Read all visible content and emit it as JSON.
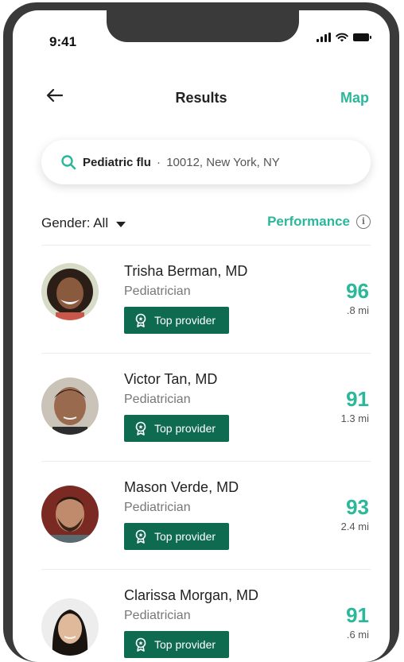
{
  "status_bar": {
    "time": "9:41"
  },
  "header": {
    "title": "Results",
    "map_label": "Map"
  },
  "search": {
    "query": "Pediatric flu",
    "separator": "·",
    "location": "10012, New York, NY"
  },
  "filters": {
    "gender_label": "Gender: All",
    "sort_label": "Performance"
  },
  "colors": {
    "accent": "#2ab79a",
    "badge": "#0e6b50"
  },
  "providers": [
    {
      "name": "Trisha Berman, MD",
      "specialty": "Pediatrician",
      "badge": "Top provider",
      "score": "96",
      "distance": ".8 mi"
    },
    {
      "name": "Victor Tan, MD",
      "specialty": "Pediatrician",
      "badge": "Top provider",
      "score": "91",
      "distance": "1.3 mi"
    },
    {
      "name": "Mason Verde, MD",
      "specialty": "Pediatrician",
      "badge": "Top provider",
      "score": "93",
      "distance": "2.4 mi"
    },
    {
      "name": "Clarissa Morgan, MD",
      "specialty": "Pediatrician",
      "badge": "Top provider",
      "score": "91",
      "distance": ".6 mi"
    }
  ]
}
